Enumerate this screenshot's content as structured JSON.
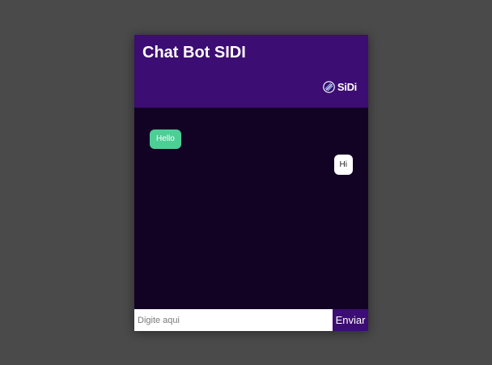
{
  "header": {
    "title": "Chat Bot SIDI",
    "brand": {
      "logo_icon": "sidi-logo-icon",
      "text": "SiDi"
    }
  },
  "messages": [
    {
      "sender": "bot",
      "text": "Hello"
    },
    {
      "sender": "user",
      "text": "Hi"
    }
  ],
  "input": {
    "value": "",
    "placeholder": "Digite aqui"
  },
  "send_button": {
    "label": "Enviar"
  },
  "colors": {
    "background": "#4a4a4a",
    "header": "#3c0d72",
    "chat_body": "#120325",
    "bot_bubble": "#4ccf95",
    "user_bubble": "#ffffff",
    "send_button": "#3c0d72"
  }
}
